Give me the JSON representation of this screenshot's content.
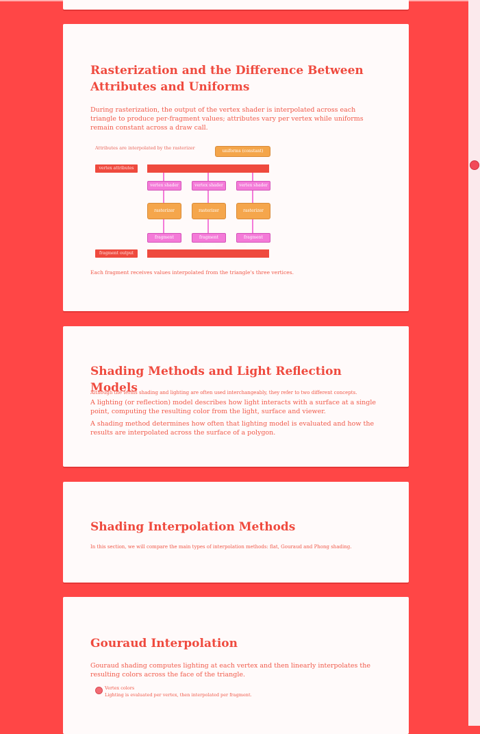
{
  "sections": [
    {
      "title": "Rasterization and the Difference Between Attributes and Uniforms",
      "para1": "During rasterization, the output of the vertex shader is interpolated across each triangle to produce per-fragment values; attributes vary per vertex while uniforms remain constant across a draw call.",
      "diagram": {
        "caption": "Attributes are interpolated by the rasterizer",
        "button_label": "uniforms (constant)",
        "label_top": "vertex attributes",
        "label_bottom": "fragment output",
        "vertex_shader": "vertex shader",
        "rasterizer": "rasterizer",
        "fragment_shader": "fragment shader",
        "note": "Each fragment receives values interpolated from the triangle's three vertices."
      }
    },
    {
      "title": "Shading Methods and Light Reflection Models",
      "para_small": "Although the terms shading and lighting are often used interchangeably, they refer to two different concepts.",
      "para1": "A lighting (or reflection) model describes how light interacts with a surface at a single point, computing the resulting color from the light, surface and viewer.",
      "para2": "A shading method determines how often that lighting model is evaluated and how the results are interpolated across the surface of a polygon."
    },
    {
      "title": "Shading Interpolation Methods",
      "para_small": "In this section, we will compare the main types of interpolation methods: flat, Gouraud and Phong shading."
    },
    {
      "title": "Gouraud Interpolation",
      "para1": "Gouraud shading computes lighting at each vertex and then linearly interpolates the resulting colors across the face of the triangle.",
      "bullet_title": "Vertex colors",
      "bullet_text": "Lighting is evaluated per vertex, then interpolated per fragment."
    }
  ]
}
